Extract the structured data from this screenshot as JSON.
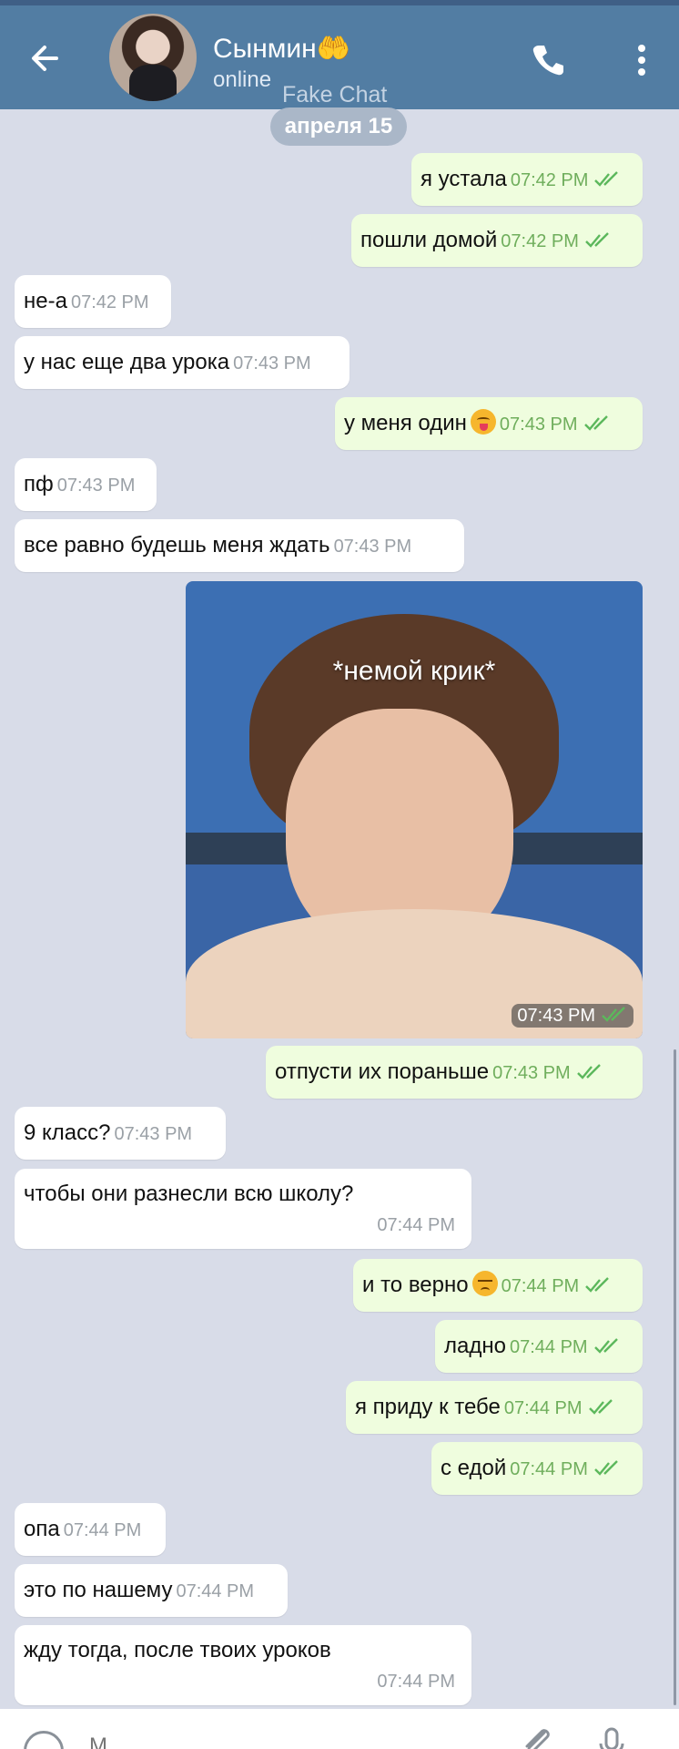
{
  "header": {
    "contact_name": "Сынмин🤲",
    "status": "online",
    "watermark": "Fake Chat"
  },
  "date_badge": "апреля 15",
  "messages": [
    {
      "side": "out",
      "text": "я устала",
      "time": "07:42 PM"
    },
    {
      "side": "out",
      "text": "пошли домой",
      "time": "07:42 PM"
    },
    {
      "side": "in",
      "text": "не-а",
      "time": "07:42 PM"
    },
    {
      "side": "in",
      "text": "у нас еще два урока",
      "time": "07:43 PM"
    },
    {
      "side": "out",
      "text": "у меня один",
      "time": "07:43 PM",
      "emoji": "face-with-tongue"
    },
    {
      "side": "in",
      "text": "пф",
      "time": "07:43 PM"
    },
    {
      "side": "in",
      "text": "все равно будешь меня ждать",
      "time": "07:43 PM"
    },
    {
      "side": "out",
      "type": "image",
      "caption": "*немой крик*",
      "time": "07:43 PM"
    },
    {
      "side": "out",
      "text": "отпусти их пораньше",
      "time": "07:43 PM"
    },
    {
      "side": "in",
      "text": "9 класс?",
      "time": "07:43 PM"
    },
    {
      "side": "in",
      "text": "чтобы они разнесли всю школу?",
      "time": "07:44 PM"
    },
    {
      "side": "out",
      "text": "и то верно",
      "time": "07:44 PM",
      "emoji": "disappointed-face"
    },
    {
      "side": "out",
      "text": "ладно",
      "time": "07:44 PM"
    },
    {
      "side": "out",
      "text": "я приду к тебе",
      "time": "07:44 PM"
    },
    {
      "side": "out",
      "text": "с едой",
      "time": "07:44 PM"
    },
    {
      "side": "in",
      "text": "опа",
      "time": "07:44 PM"
    },
    {
      "side": "in",
      "text": "это по нашему",
      "time": "07:44 PM"
    },
    {
      "side": "in",
      "text": "жду тогда, после твоих уроков",
      "time": "07:44 PM"
    }
  ],
  "input": {
    "placeholder": "M"
  },
  "icons": {
    "back": "arrow-left-icon",
    "call": "phone-icon",
    "menu": "more-vertical-icon",
    "read": "double-check-icon",
    "emoji": "smile-icon",
    "attach": "paperclip-icon",
    "mic": "microphone-icon"
  },
  "colors": {
    "header": "#527da3",
    "chat_background": "#d8dce8",
    "incoming_bubble": "#ffffff",
    "outgoing_bubble": "#effdde",
    "read_check": "#5cb85c"
  }
}
